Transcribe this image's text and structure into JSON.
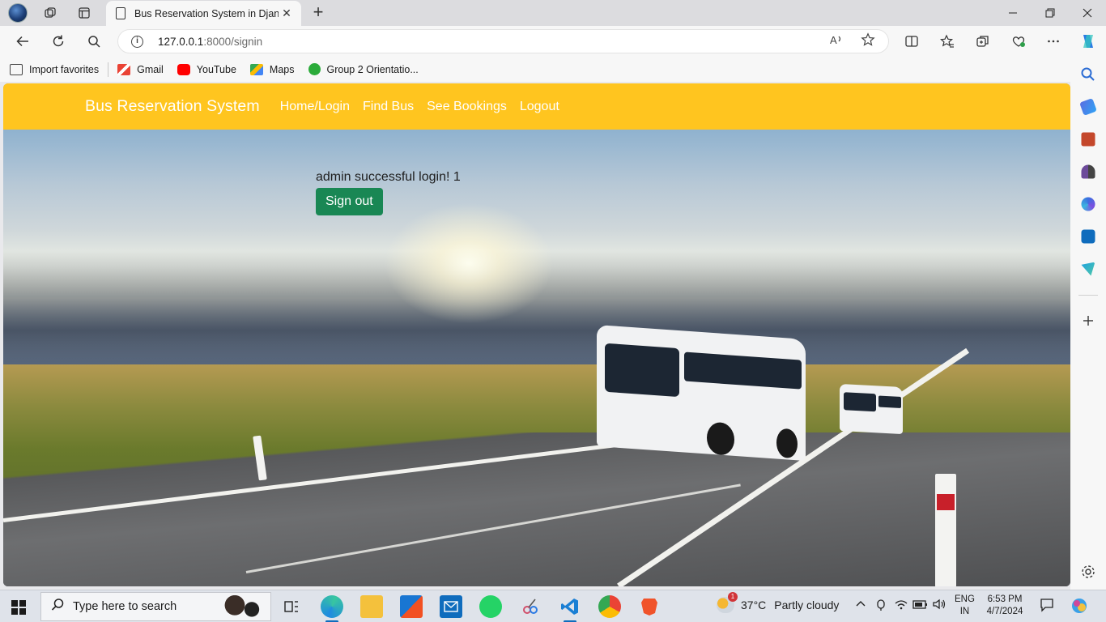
{
  "browser": {
    "tab_title": "Bus Reservation System in Djang",
    "tab_close": "✕",
    "new_tab": "+",
    "url_host": "127.0.0.1",
    "url_rest": ":8000/signin",
    "favorites": [
      {
        "label": "Import favorites",
        "icon": "import-favorites-icon",
        "color": "#444444"
      },
      {
        "label": "Gmail",
        "icon": "gmail-icon",
        "color": "#ea4335"
      },
      {
        "label": "YouTube",
        "icon": "youtube-icon",
        "color": "#ff0000"
      },
      {
        "label": "Maps",
        "icon": "maps-icon",
        "color": "#34a853"
      },
      {
        "label": "Group 2 Orientatio...",
        "icon": "group-icon",
        "color": "#2bab3a"
      }
    ]
  },
  "site": {
    "brand": "Bus Reservation System",
    "nav": [
      "Home/Login",
      "Find Bus",
      "See Bookings",
      "Logout"
    ],
    "nav_color": "#ffc51f",
    "message": "admin successful login! 1",
    "signout_label": "Sign out",
    "signout_color": "#198754"
  },
  "taskbar": {
    "search_placeholder": "Type here to search",
    "weather_temp": "37°C",
    "weather_desc": "Partly cloudy",
    "weather_badge": "1",
    "lang_line1": "ENG",
    "lang_line2": "IN",
    "time": "6:53 PM",
    "date": "4/7/2024"
  }
}
